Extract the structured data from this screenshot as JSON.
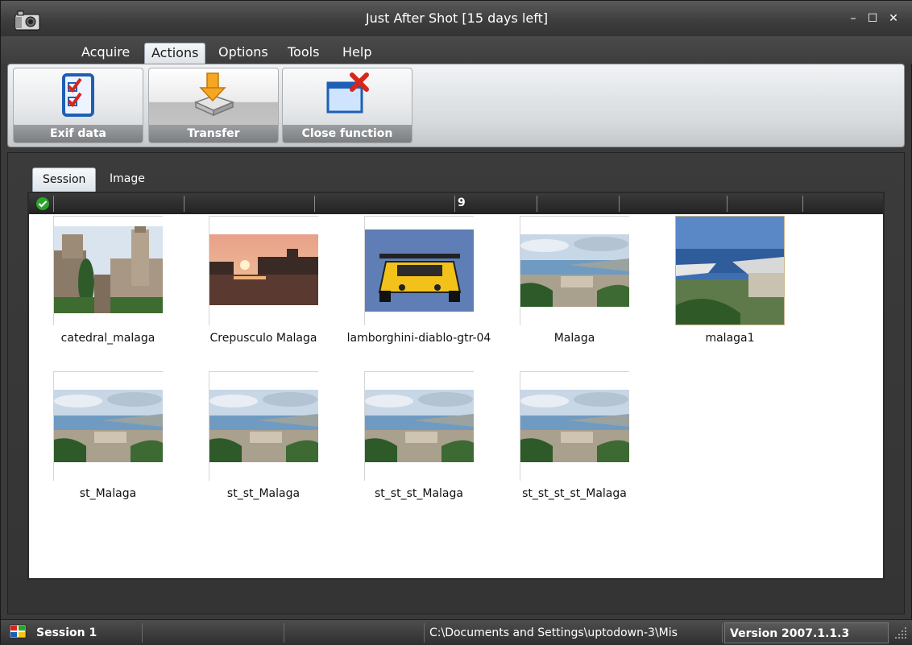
{
  "window": {
    "title": "Just After Shot [15 days left]",
    "minimize_label": "–",
    "maximize_label": "☐",
    "close_label": "✕"
  },
  "menu": {
    "items": [
      {
        "label": "Acquire"
      },
      {
        "label": "Actions",
        "active": true
      },
      {
        "label": "Options"
      },
      {
        "label": "Tools"
      },
      {
        "label": "Help"
      }
    ]
  },
  "ribbon": {
    "buttons": [
      {
        "label": "Exif data",
        "icon": "checklist-icon"
      },
      {
        "label": "Transfer",
        "icon": "transfer-icon",
        "pressed": true
      },
      {
        "label": "Close function",
        "icon": "close-window-icon"
      }
    ]
  },
  "tabs": [
    {
      "label": "Session",
      "active": true
    },
    {
      "label": "Image"
    }
  ],
  "gallery": {
    "count": "9",
    "items": [
      {
        "name": "catedral_malaga",
        "image": "cathedral"
      },
      {
        "name": "Crepusculo Malaga",
        "image": "sunset"
      },
      {
        "name": "lamborghini-diablo-gtr-04",
        "image": "car"
      },
      {
        "name": "Malaga",
        "image": "coast"
      },
      {
        "name": "malaga1",
        "image": "harbor"
      },
      {
        "name": "st_Malaga",
        "image": "coast"
      },
      {
        "name": "st_st_Malaga",
        "image": "coast"
      },
      {
        "name": "st_st_st_Malaga",
        "image": "coast"
      },
      {
        "name": "st_st_st_st_Malaga",
        "image": "coast"
      }
    ]
  },
  "status": {
    "session": "Session 1",
    "path": "C:\\Documents and Settings\\uptodown-3\\Mis",
    "version": "Version 2007.1.1.3"
  },
  "colors": {
    "chrome_dark": "#3a3a3a",
    "ribbon_light": "#e6e8ea",
    "check_green": "#2aa52a",
    "close_red": "#d8261c"
  }
}
